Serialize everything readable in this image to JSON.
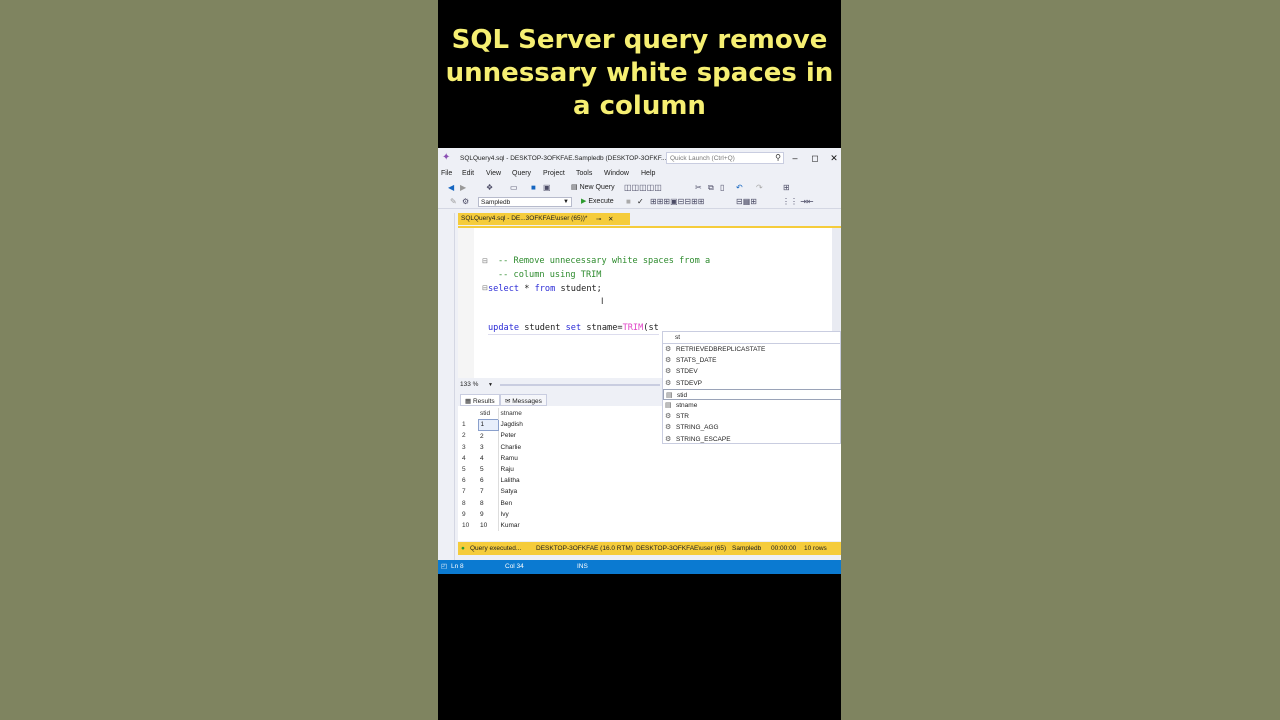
{
  "banner": {
    "title": "SQL Server query remove unnessary white spaces in a column"
  },
  "window": {
    "title": "SQLQuery4.sql - DESKTOP-3OFKFAE.Sampledb (DESKTOP-3OFKF...",
    "quick_launch_placeholder": "Quick Launch (Ctrl+Q)"
  },
  "menu": [
    "File",
    "Edit",
    "View",
    "Query",
    "Project",
    "Tools",
    "Window",
    "Help"
  ],
  "toolbar": {
    "new_query_label": "New Query",
    "database": "Sampledb",
    "execute_label": "Execute"
  },
  "tab": {
    "label": "SQLQuery4.sql - DE...3OFKFAE\\user (65))*"
  },
  "editor": {
    "line1": "-- Remove unnecessary white spaces from a",
    "line2": "-- column using TRIM",
    "line3_kw1": "select",
    "line3_rest": " * ",
    "line3_kw2": "from",
    "line3_end": " student;",
    "line4_kw1": "update",
    "line4_a": " student ",
    "line4_kw2": "set",
    "line4_b": " stname=",
    "line4_fn": "TRIM",
    "line4_c": "(st"
  },
  "zoom": "133 %",
  "results": {
    "tabs": [
      "Results",
      "Messages"
    ],
    "columns": [
      "stid",
      "stname"
    ],
    "rows": [
      {
        "n": "1",
        "stid": "1",
        "stname": "Jagdish"
      },
      {
        "n": "2",
        "stid": "2",
        "stname": "Peter"
      },
      {
        "n": "3",
        "stid": "3",
        "stname": "Charlie"
      },
      {
        "n": "4",
        "stid": "4",
        "stname": "Ramu"
      },
      {
        "n": "5",
        "stid": "5",
        "stname": "Raju"
      },
      {
        "n": "6",
        "stid": "6",
        "stname": "Lalitha"
      },
      {
        "n": "7",
        "stid": "7",
        "stname": "Satya"
      },
      {
        "n": "8",
        "stid": "8",
        "stname": "Ben"
      },
      {
        "n": "9",
        "stid": "9",
        "stname": "Ivy"
      },
      {
        "n": "10",
        "stid": "10",
        "stname": "Kumar"
      }
    ]
  },
  "autocomplete": {
    "filter": "st",
    "items": [
      "RETRIEVEDBREPLICASTATE",
      "STATS_DATE",
      "STDEV",
      "STDEVP",
      "stid",
      "stname",
      "STR",
      "STRING_AGG",
      "STRING_ESCAPE"
    ],
    "selected": "stid"
  },
  "status": {
    "query": "Query executed...",
    "server": "DESKTOP-3OFKFAE (16.0 RTM)",
    "user": "DESKTOP-3OFKFAE\\user (65)",
    "db": "Sampledb",
    "time": "00:00:00",
    "rows": "10 rows"
  },
  "bottom_status": {
    "ln": "Ln 8",
    "col": "Col 34",
    "mode": "INS"
  },
  "colors": {
    "banner_text": "#f6ef72",
    "accent_yellow": "#f5cc3b",
    "status_blue": "#0b7ad1",
    "keyword": "#2b2bd6",
    "comment": "#2e8b2e",
    "function": "#e044c7"
  }
}
